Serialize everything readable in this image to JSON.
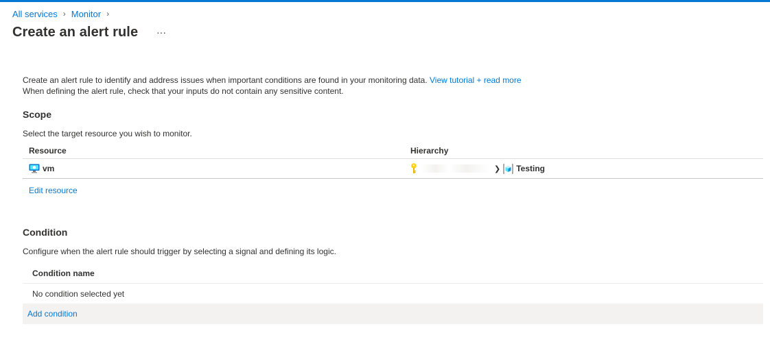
{
  "breadcrumb": {
    "items": [
      "All services",
      "Monitor"
    ]
  },
  "page": {
    "title": "Create an alert rule",
    "more_label": "···"
  },
  "intro": {
    "line1": "Create an alert rule to identify and address issues when important conditions are found in your monitoring data.",
    "tutorial_link": "View tutorial + read more",
    "line2": "When defining the alert rule, check that your inputs do not contain any sensitive content."
  },
  "scope": {
    "title": "Scope",
    "subtitle": "Select the target resource you wish to monitor.",
    "columns": [
      "Resource",
      "Hierarchy"
    ],
    "rows": [
      {
        "resource": "vm",
        "resource_icon": "virtual-machine-icon",
        "hierarchy_target": "Testing"
      }
    ],
    "edit_link": "Edit resource"
  },
  "condition": {
    "title": "Condition",
    "subtitle": "Configure when the alert rule should trigger by selecting a signal and defining its logic.",
    "column": "Condition name",
    "empty_text": "No condition selected yet",
    "add_link": "Add condition"
  },
  "colors": {
    "accent": "#0078d4",
    "text": "#323130",
    "row_shade": "#f3f2f1"
  }
}
